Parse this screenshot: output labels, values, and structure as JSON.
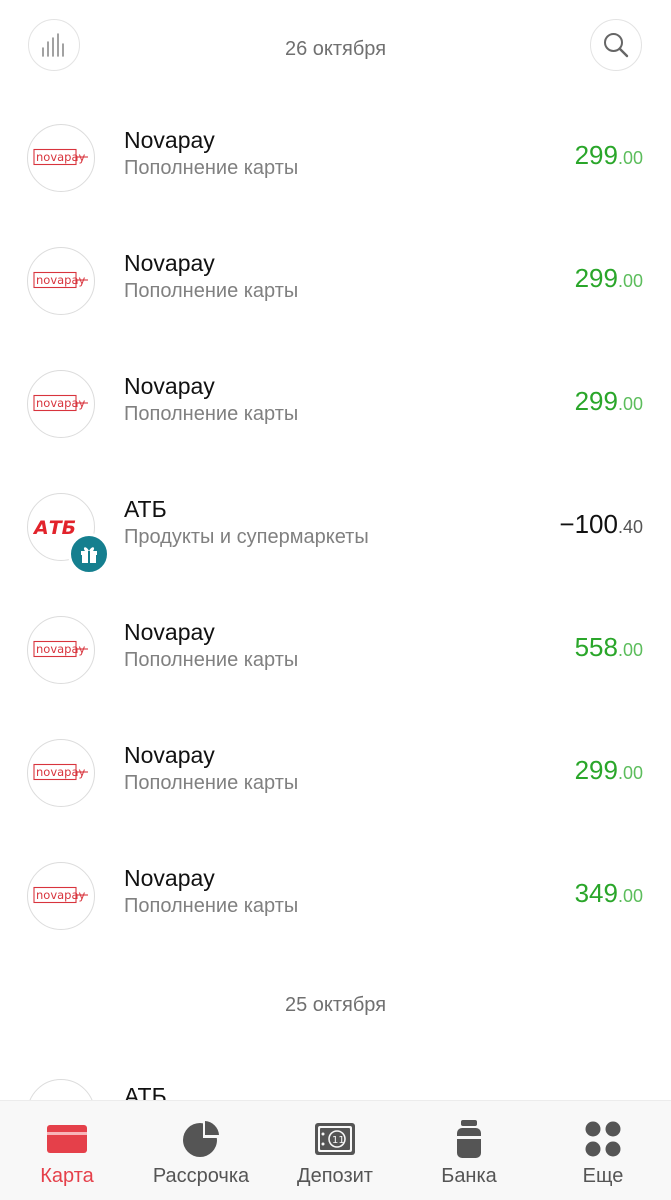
{
  "header": {
    "stats_icon": "bar-chart-icon",
    "search_icon": "search-icon"
  },
  "groups": [
    {
      "date": "26 октября",
      "transactions": [
        {
          "merchant": "Novapay",
          "logo_text": "novapay",
          "category": "Пополнение карты",
          "amount_int": "299",
          "amount_frac": ".00",
          "sign": "positive"
        },
        {
          "merchant": "Novapay",
          "logo_text": "novapay",
          "category": "Пополнение карты",
          "amount_int": "299",
          "amount_frac": ".00",
          "sign": "positive"
        },
        {
          "merchant": "Novapay",
          "logo_text": "novapay",
          "category": "Пополнение карты",
          "amount_int": "299",
          "amount_frac": ".00",
          "sign": "positive"
        },
        {
          "merchant": "АТБ",
          "logo_text": "АТБ",
          "category": "Продукты и супермаркеты",
          "amount_int": "−100",
          "amount_frac": ".40",
          "sign": "negative",
          "badge": "gift-icon"
        },
        {
          "merchant": "Novapay",
          "logo_text": "novapay",
          "category": "Пополнение карты",
          "amount_int": "558",
          "amount_frac": ".00",
          "sign": "positive"
        },
        {
          "merchant": "Novapay",
          "logo_text": "novapay",
          "category": "Пополнение карты",
          "amount_int": "299",
          "amount_frac": ".00",
          "sign": "positive"
        },
        {
          "merchant": "Novapay",
          "logo_text": "novapay",
          "category": "Пополнение карты",
          "amount_int": "349",
          "amount_frac": ".00",
          "sign": "positive"
        }
      ]
    },
    {
      "date": "25 октября",
      "transactions": [
        {
          "merchant": "АТБ"
        }
      ]
    }
  ],
  "colors": {
    "positive": "#2aa62a",
    "accent": "#e5404a",
    "badge": "#157f8f"
  },
  "nav": [
    {
      "label": "Карта",
      "icon": "card-icon",
      "active": true
    },
    {
      "label": "Рассрочка",
      "icon": "pie-chart-icon",
      "active": false
    },
    {
      "label": "Депозит",
      "icon": "deposit-icon",
      "active": false
    },
    {
      "label": "Банка",
      "icon": "jar-icon",
      "active": false
    },
    {
      "label": "Еще",
      "icon": "more-icon",
      "active": false
    }
  ]
}
